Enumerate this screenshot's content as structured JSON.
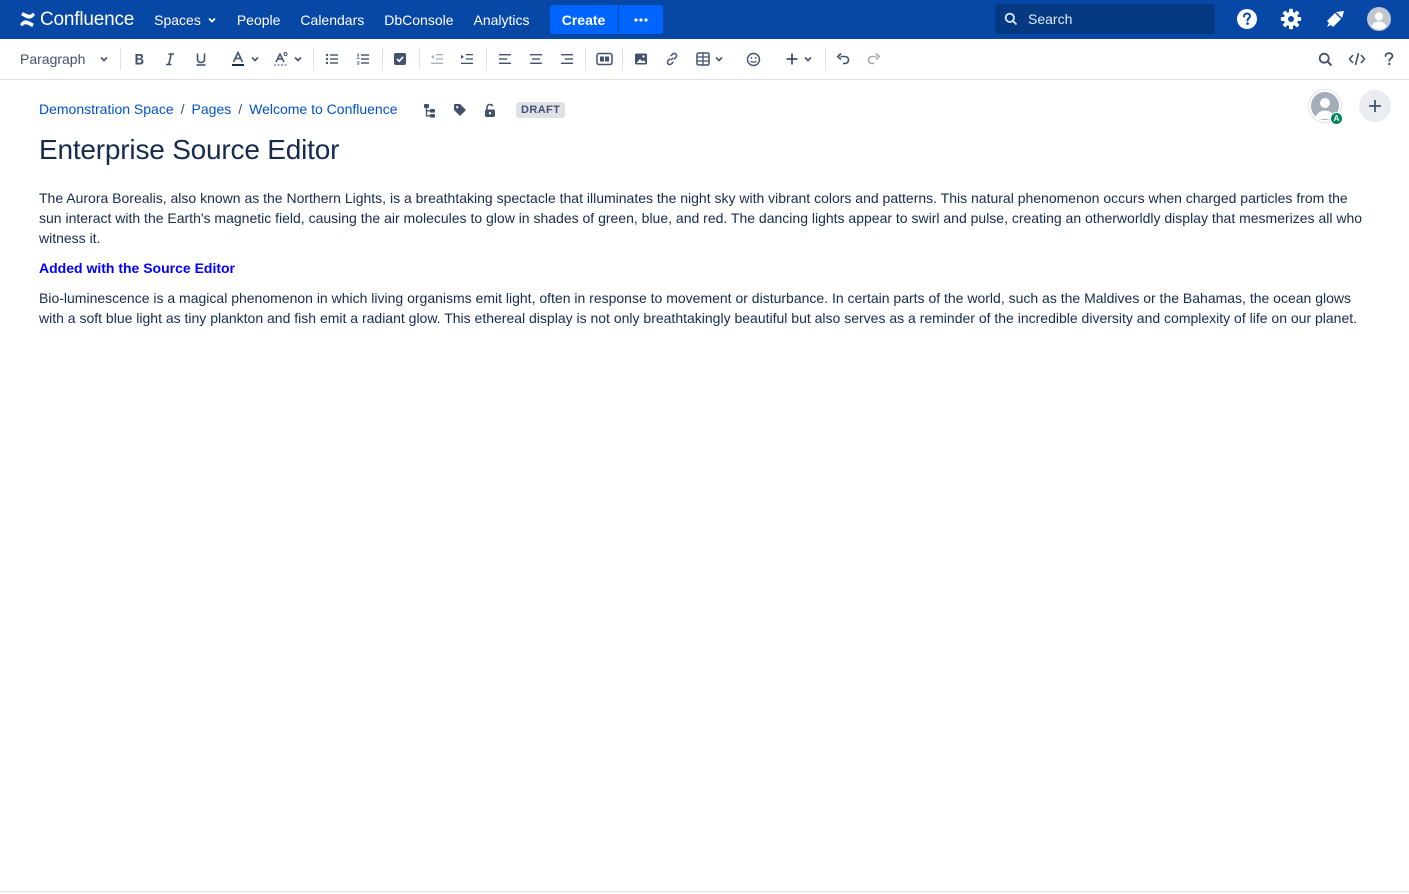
{
  "nav": {
    "logo_text": "Confluence",
    "spaces": "Spaces",
    "people": "People",
    "calendars": "Calendars",
    "dbconsole": "DbConsole",
    "analytics": "Analytics",
    "create": "Create",
    "more": "···",
    "search_placeholder": "Search"
  },
  "toolbar": {
    "paragraph": "Paragraph"
  },
  "breadcrumb": {
    "space": "Demonstration Space",
    "pages": "Pages",
    "parent": "Welcome to Confluence",
    "separator": "/"
  },
  "status_badge": "DRAFT",
  "collaborator_badge": "A",
  "page": {
    "title": "Enterprise Source Editor",
    "paragraphs": [
      "The Aurora Borealis, also known as the Northern Lights, is a breathtaking spectacle that illuminates the night sky with vibrant colors and patterns. This natural phenomenon occurs when charged particles from the sun interact with the Earth's magnetic field, causing the air molecules to glow in shades of green, blue, and red. The dancing lights appear to swirl and pulse, creating an otherworldly display that mesmerizes all who witness it.",
      "Added with the Source Editor",
      "Bio-luminescence is a magical phenomenon in which living organisms emit light, often in response to movement or disturbance. In certain parts of the world, such as the Maldives or the Bahamas, the ocean glows with a soft blue light as tiny plankton and fish emit a radiant glow. This ethereal display is not only breathtakingly beautiful but also serves as a reminder of the incredible diversity and complexity of life on our planet."
    ]
  },
  "colors": {
    "nav_bg": "#0747a6",
    "create_bg": "#0065ff",
    "link": "#0052cc",
    "source_text": "#0000ff",
    "presence": "#00875a"
  }
}
